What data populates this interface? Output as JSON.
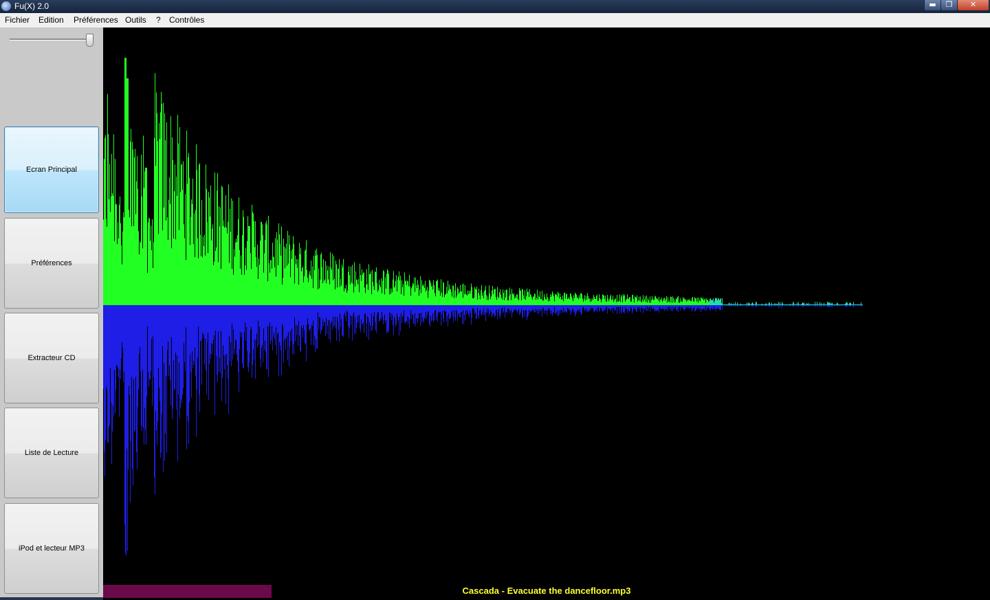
{
  "window": {
    "title": "Fu(X) 2.0",
    "controls": {
      "minimize": "▬",
      "maximize": "❐",
      "close": "✕"
    }
  },
  "menu": [
    "Fichier",
    "Edition",
    "Préférences",
    "Outils",
    "?",
    "Contrôles"
  ],
  "sidebar": {
    "volume_level": 0.98,
    "buttons": [
      {
        "label": "Ecran Principal",
        "active": true
      },
      {
        "label": "Préférences",
        "active": false
      },
      {
        "label": "Extracteur CD",
        "active": false
      },
      {
        "label": "Liste de Lecture",
        "active": false
      },
      {
        "label": "iPod et lecteur MP3",
        "active": false
      }
    ]
  },
  "player": {
    "now_playing": "Cascada - Evacuate the dancefloor.mp3",
    "progress": 0.19
  },
  "colors": {
    "spectrum_top": "#22ff22",
    "spectrum_bottom": "#1e1ee6",
    "progress_bar": "#6b0a4a",
    "track_title": "#ffff33",
    "background": "#000000"
  },
  "icons": {
    "app": "globe-icon",
    "minimize": "minimize-icon",
    "maximize": "maximize-icon",
    "close": "close-icon"
  }
}
